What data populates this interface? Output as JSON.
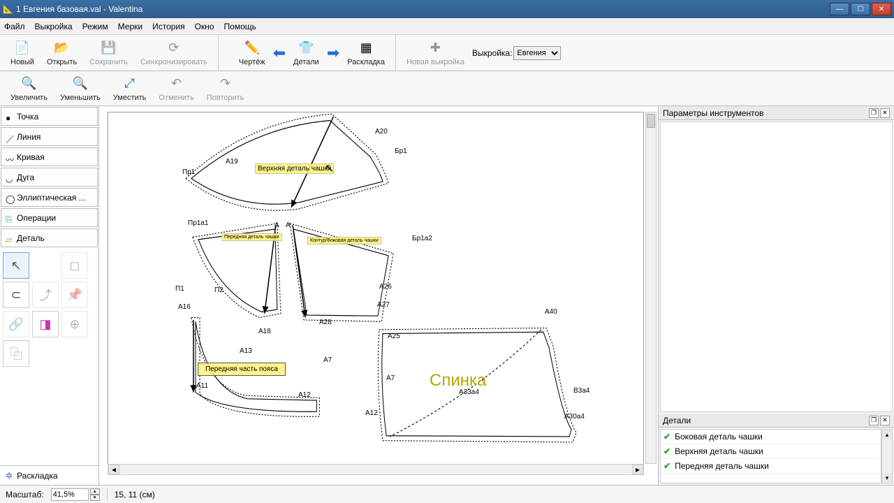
{
  "window": {
    "title": "1 Евгения базовая.val - Valentina"
  },
  "menu": {
    "file": "Файл",
    "pattern": "Выкройка",
    "mode": "Режим",
    "measurements": "Мерки",
    "history": "История",
    "window": "Окно",
    "help": "Помощь"
  },
  "toolbar1": {
    "new": "Новый",
    "open": "Открыть",
    "save": "Сохранить",
    "sync": "Синхронизировать",
    "draw": "Чертёж",
    "details": "Детали",
    "layout": "Раскладка",
    "newpattern": "Новая выкройка",
    "patternlabel": "Выкройка:",
    "patternvalue": "Евгения"
  },
  "toolbar2": {
    "zoomin": "Увеличить",
    "zoomout": "Уменьшить",
    "fit": "Уместить",
    "undo": "Отменить",
    "redo": "Повторить"
  },
  "toolcats": {
    "point": "Точка",
    "line": "Линия",
    "curve": "Кривая",
    "arc": "Дуга",
    "elliptic": "Эллиптическая ...",
    "ops": "Операции",
    "detail": "Деталь",
    "layout": "Раскладка"
  },
  "right": {
    "params_title": "Параметры инструментов",
    "details_title": "Детали",
    "details": [
      "Боковая деталь чашки",
      "Верхняя деталь чашки",
      "Передняя деталь чашки"
    ]
  },
  "labels_on_canvas": {
    "top": "Верхняя деталь чашки",
    "front_small": "Передняя деталь чашки",
    "side_small": "Контур/Боковая деталь чашки",
    "belt": "Передняя часть пояса",
    "back": "Спинка"
  },
  "points": {
    "A20": "А20",
    "Bp1": "Бр1",
    "A19": "А19",
    "Pr1": "Пр1",
    "Pr1a1": "Пр1a1",
    "A": "А",
    "Bp1a2": "Бр1a2",
    "P1": "П1",
    "P2": "П2",
    "A16": "А16",
    "A18": "А18",
    "A13": "А13",
    "A7": "А7",
    "A11": "А11",
    "A12": "А12",
    "A28": "А28",
    "A26": "А26",
    "A27": "А27",
    "A25": "А25",
    "A7b": "А7",
    "A40": "А40",
    "B3a4": "В3a4",
    "A30a4": "А30a4",
    "A12b": "А12",
    "A33a4": "А33a4"
  },
  "status": {
    "scale_label": "Масштаб:",
    "scale_value": "41,5%",
    "coords": "15, 11 (см)"
  }
}
